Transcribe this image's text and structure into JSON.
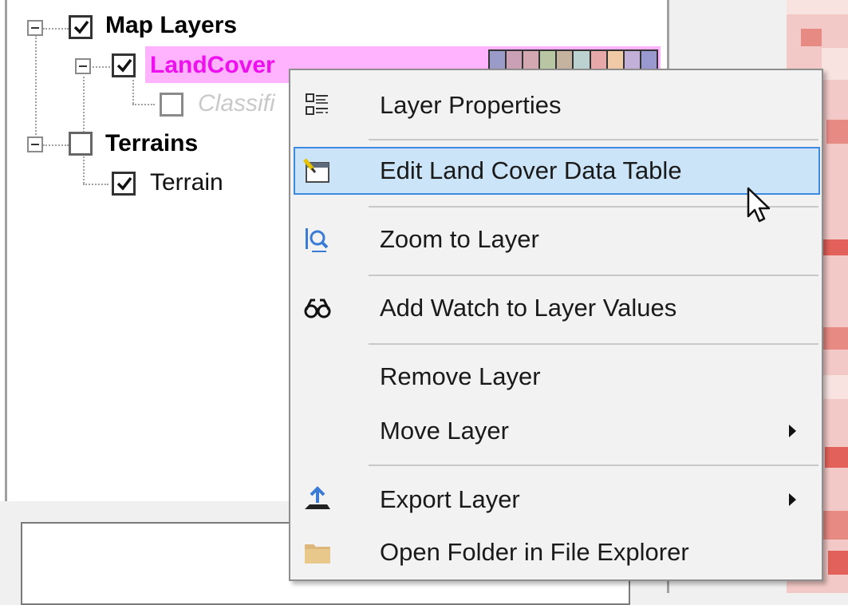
{
  "tree": {
    "nodes": [
      {
        "id": "map-layers",
        "label": "Map Layers",
        "checked": true
      },
      {
        "id": "landcover",
        "label": "LandCover",
        "checked": true
      },
      {
        "id": "classified",
        "label": "Classifi",
        "checked": false
      },
      {
        "id": "terrains",
        "label": "Terrains",
        "checked": false
      },
      {
        "id": "terrain",
        "label": "Terrain",
        "checked": true
      }
    ],
    "landcover_swatch_colors": [
      "#9b9bc9",
      "#c9a0b4",
      "#d4a8b0",
      "#b9c6a3",
      "#c5b3a0",
      "#bcd2d0",
      "#e6a8a8",
      "#f0c9a6",
      "#c3b0d8",
      "#9999d0"
    ]
  },
  "context_menu": {
    "items": [
      {
        "label": "Layer Properties",
        "icon": "properties-icon"
      },
      {
        "label": "Edit Land Cover Data Table",
        "icon": "edit-table-icon",
        "highlighted": true
      },
      {
        "label": "Zoom to Layer",
        "icon": "zoom-to-layer-icon"
      },
      {
        "label": "Add Watch to Layer Values",
        "icon": "glasses-icon"
      },
      {
        "label": "Remove Layer",
        "icon": ""
      },
      {
        "label": "Move Layer",
        "icon": "",
        "submenu": true
      },
      {
        "label": "Export Layer",
        "icon": "export-icon",
        "submenu": true
      },
      {
        "label": "Open Folder in File Explorer",
        "icon": "folder-icon"
      }
    ]
  },
  "colors": {
    "highlight_bg": "#cce4f7",
    "highlight_border": "#3c8be0",
    "landcover_text": "#ee10ee",
    "landcover_row_bg": "#ffb3ff",
    "map_background": "#f2c9c6"
  }
}
